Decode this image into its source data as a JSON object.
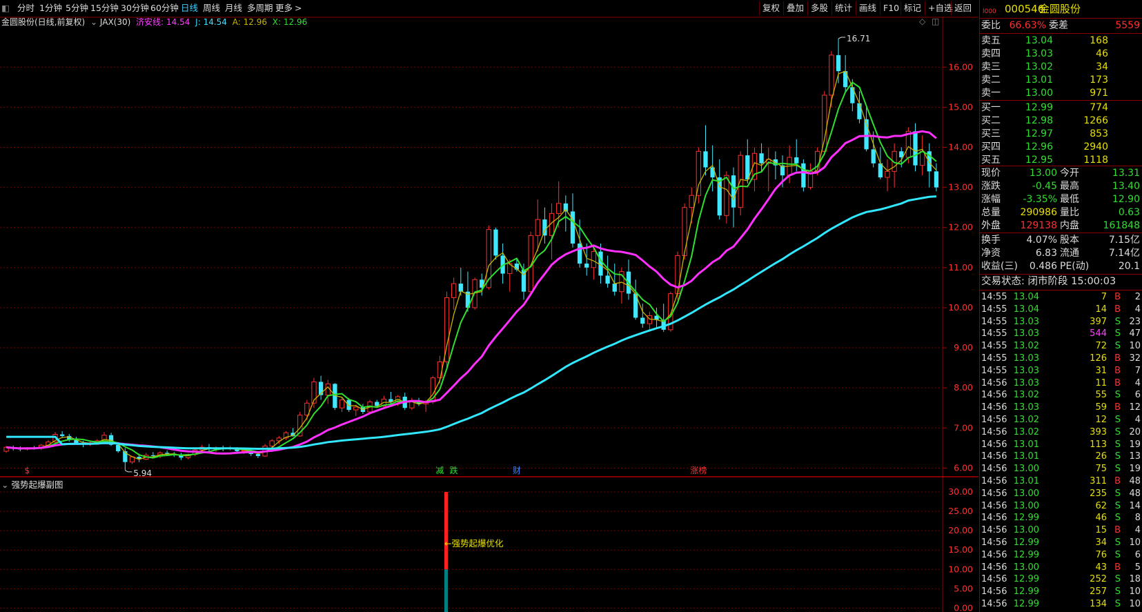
{
  "toolbar": {
    "periods": [
      "分时",
      "1分钟",
      "5分钟",
      "15分钟",
      "30分钟",
      "60分钟",
      "日线",
      "周线",
      "月线",
      "多周期",
      "更多"
    ],
    "active_period": "日线",
    "right_buttons": [
      "复权",
      "叠加",
      "多股",
      "统计",
      "画线",
      "F10",
      "标记",
      "+自选",
      "返回"
    ]
  },
  "legend": {
    "stock_title": "金圆股份(日线,前复权)",
    "indicator": "JAX(30)",
    "items": [
      {
        "label": "济安线: 14.54",
        "color": "#ff40ff"
      },
      {
        "label": "J: 14.54",
        "color": "#40e0ff"
      },
      {
        "label": "A: 12.96",
        "color": "#c8b400"
      },
      {
        "label": "X: 12.96",
        "color": "#30e030"
      }
    ]
  },
  "sub_chart": {
    "title": "强势起爆副图",
    "annotation": "←强势起爆优化",
    "y_labels": [
      "30.00",
      "25.00",
      "20.00",
      "15.00",
      "10.00",
      "5.00",
      "0.00"
    ],
    "bar": {
      "red_top": 30,
      "red_bottom": 10,
      "teal_top": 10,
      "teal_bottom": -1
    }
  },
  "chart_data": {
    "type": "candlestick",
    "y_labels": [
      "16.00",
      "15.00",
      "14.00",
      "13.00",
      "12.00",
      "11.00",
      "10.00",
      "9.00",
      "8.00",
      "7.00",
      "6.00"
    ],
    "ylim": [
      5.8,
      16.9
    ],
    "high_label": "16.71",
    "low_label": "5.94",
    "event_markers": [
      {
        "text": "$",
        "index": 3,
        "color": "#ff3030"
      },
      {
        "text": "减",
        "index": 62,
        "color": "#30e030"
      },
      {
        "text": "跌",
        "index": 64,
        "color": "#30e030"
      },
      {
        "text": "财",
        "index": 73,
        "color": "#4080ff"
      },
      {
        "text": "涨榜",
        "index": 99,
        "color": "#ff3030"
      }
    ],
    "candles": [
      [
        6.42,
        6.55,
        6.38,
        6.52
      ],
      [
        6.5,
        6.56,
        6.44,
        6.48
      ],
      [
        6.48,
        6.54,
        6.42,
        6.47
      ],
      [
        6.47,
        6.52,
        6.44,
        6.5
      ],
      [
        6.5,
        6.55,
        6.46,
        6.49
      ],
      [
        6.49,
        6.6,
        6.45,
        6.57
      ],
      [
        6.57,
        6.7,
        6.52,
        6.65
      ],
      [
        6.65,
        6.9,
        6.6,
        6.84
      ],
      [
        6.84,
        6.92,
        6.75,
        6.8
      ],
      [
        6.8,
        6.85,
        6.66,
        6.7
      ],
      [
        6.7,
        6.78,
        6.6,
        6.62
      ],
      [
        6.62,
        6.68,
        6.52,
        6.6
      ],
      [
        6.6,
        6.66,
        6.55,
        6.63
      ],
      [
        6.63,
        6.72,
        6.58,
        6.68
      ],
      [
        6.68,
        6.9,
        6.62,
        6.82
      ],
      [
        6.82,
        6.88,
        6.55,
        6.58
      ],
      [
        6.58,
        6.62,
        6.38,
        6.42
      ],
      [
        6.42,
        6.5,
        5.94,
        6.15
      ],
      [
        6.15,
        6.3,
        6.1,
        6.28
      ],
      [
        6.28,
        6.36,
        6.15,
        6.22
      ],
      [
        6.22,
        6.38,
        6.2,
        6.32
      ],
      [
        6.32,
        6.4,
        6.25,
        6.3
      ],
      [
        6.3,
        6.42,
        6.25,
        6.38
      ],
      [
        6.38,
        6.44,
        6.3,
        6.36
      ],
      [
        6.36,
        6.4,
        6.28,
        6.32
      ],
      [
        6.32,
        6.38,
        6.2,
        6.26
      ],
      [
        6.26,
        6.36,
        6.22,
        6.34
      ],
      [
        6.34,
        6.5,
        6.3,
        6.45
      ],
      [
        6.45,
        6.58,
        6.4,
        6.52
      ],
      [
        6.52,
        6.6,
        6.42,
        6.47
      ],
      [
        6.47,
        6.54,
        6.4,
        6.5
      ],
      [
        6.5,
        6.56,
        6.42,
        6.48
      ],
      [
        6.48,
        6.55,
        6.44,
        6.5
      ],
      [
        6.5,
        6.52,
        6.38,
        6.42
      ],
      [
        6.42,
        6.48,
        6.35,
        6.44
      ],
      [
        6.44,
        6.46,
        6.3,
        6.35
      ],
      [
        6.35,
        6.42,
        6.25,
        6.3
      ],
      [
        6.3,
        6.6,
        6.28,
        6.55
      ],
      [
        6.55,
        6.72,
        6.5,
        6.68
      ],
      [
        6.68,
        6.8,
        6.6,
        6.75
      ],
      [
        6.75,
        6.92,
        6.7,
        6.88
      ],
      [
        6.88,
        7.0,
        6.78,
        6.8
      ],
      [
        6.8,
        7.4,
        6.78,
        7.32
      ],
      [
        7.32,
        7.7,
        7.2,
        7.62
      ],
      [
        7.62,
        8.25,
        7.5,
        8.15
      ],
      [
        8.15,
        8.3,
        7.7,
        7.82
      ],
      [
        7.82,
        8.2,
        7.6,
        8.1
      ],
      [
        8.1,
        8.12,
        7.45,
        7.5
      ],
      [
        7.5,
        7.78,
        7.4,
        7.7
      ],
      [
        7.7,
        7.75,
        7.4,
        7.45
      ],
      [
        7.45,
        7.58,
        7.3,
        7.52
      ],
      [
        7.52,
        7.6,
        7.35,
        7.4
      ],
      [
        7.4,
        7.7,
        7.38,
        7.65
      ],
      [
        7.65,
        7.7,
        7.5,
        7.55
      ],
      [
        7.55,
        7.8,
        7.48,
        7.72
      ],
      [
        7.72,
        7.9,
        7.6,
        7.65
      ],
      [
        7.65,
        7.82,
        7.55,
        7.78
      ],
      [
        7.78,
        7.88,
        7.45,
        7.5
      ],
      [
        7.5,
        7.75,
        7.45,
        7.68
      ],
      [
        7.68,
        7.75,
        7.55,
        7.6
      ],
      [
        7.6,
        7.7,
        7.4,
        7.65
      ],
      [
        7.65,
        8.3,
        7.6,
        8.25
      ],
      [
        8.25,
        8.8,
        8.1,
        8.65
      ],
      [
        8.65,
        10.4,
        8.5,
        10.25
      ],
      [
        10.25,
        10.75,
        9.95,
        10.6
      ],
      [
        10.6,
        11.0,
        10.3,
        10.4
      ],
      [
        10.4,
        10.9,
        9.9,
        10.0
      ],
      [
        10.0,
        10.75,
        9.95,
        10.7
      ],
      [
        10.7,
        10.85,
        10.3,
        10.5
      ],
      [
        10.5,
        12.05,
        10.45,
        11.95
      ],
      [
        11.95,
        12.0,
        11.2,
        11.3
      ],
      [
        11.3,
        11.6,
        10.6,
        10.85
      ],
      [
        10.85,
        11.2,
        10.4,
        11.1
      ],
      [
        11.1,
        11.2,
        10.9,
        10.95
      ]
    ],
    "candles_b": [
      [
        10.95,
        11.1,
        10.2,
        10.4
      ],
      [
        10.4,
        11.9,
        10.3,
        11.8
      ],
      [
        11.8,
        12.7,
        11.4,
        12.2
      ],
      [
        12.2,
        12.5,
        11.6,
        11.8
      ],
      [
        11.8,
        12.6,
        11.2,
        12.35
      ],
      [
        12.35,
        13.15,
        12.0,
        12.6
      ],
      [
        12.6,
        12.8,
        11.9,
        12.4
      ],
      [
        12.4,
        12.85,
        11.5,
        11.6
      ],
      [
        11.6,
        12.2,
        11.0,
        11.1
      ],
      [
        11.1,
        11.6,
        10.8,
        11.0
      ],
      [
        11.0,
        11.5,
        10.7,
        11.4
      ],
      [
        11.4,
        11.6,
        10.6,
        10.8
      ],
      [
        10.8,
        11.3,
        10.5,
        10.6
      ],
      [
        10.6,
        11.1,
        10.3,
        10.4
      ],
      [
        10.4,
        11.0,
        10.1,
        10.9
      ],
      [
        10.9,
        11.2,
        10.2,
        10.35
      ],
      [
        10.35,
        10.7,
        9.7,
        9.75
      ],
      [
        9.75,
        10.1,
        9.5,
        9.6
      ],
      [
        9.6,
        9.9,
        9.4,
        9.8
      ],
      [
        9.8,
        10.0,
        9.5,
        9.7
      ],
      [
        9.7,
        10.1,
        9.4,
        9.45
      ],
      [
        9.45,
        10.4,
        9.4,
        10.35
      ],
      [
        10.35,
        11.4,
        10.2,
        11.3
      ],
      [
        11.3,
        12.6,
        11.2,
        12.5
      ],
      [
        12.5,
        13.0,
        12.1,
        12.8
      ],
      [
        12.8,
        14.0,
        12.6,
        13.9
      ],
      [
        13.9,
        14.55,
        13.3,
        13.5
      ],
      [
        13.5,
        14.05,
        12.9,
        13.25
      ],
      [
        13.25,
        13.7,
        12.2,
        12.3
      ],
      [
        12.3,
        13.4,
        12.1,
        13.3
      ],
      [
        13.3,
        13.5,
        12.0,
        12.5
      ],
      [
        12.5,
        13.9,
        12.3,
        13.8
      ],
      [
        13.8,
        14.2,
        13.1,
        13.2
      ],
      [
        13.2,
        14.0,
        12.9,
        13.85
      ],
      [
        13.85,
        14.1,
        13.4,
        13.6
      ],
      [
        13.6,
        14.0,
        12.9,
        13.7
      ],
      [
        13.7,
        13.9,
        13.2,
        13.55
      ],
      [
        13.55,
        13.8,
        13.0,
        13.3
      ],
      [
        13.3,
        14.05,
        13.1,
        13.75
      ],
      [
        13.75,
        14.2,
        13.4,
        13.6
      ],
      [
        13.6,
        13.7,
        12.9,
        13.0
      ],
      [
        13.0,
        13.6,
        12.95,
        13.4
      ],
      [
        13.4,
        14.0,
        13.3,
        13.9
      ],
      [
        13.9,
        15.4,
        13.8,
        15.3
      ],
      [
        15.3,
        16.4,
        15.0,
        16.3
      ],
      [
        16.3,
        16.71,
        15.6,
        15.9
      ],
      [
        15.9,
        16.3,
        15.4,
        15.5
      ],
      [
        15.5,
        15.7,
        14.9,
        15.1
      ],
      [
        15.1,
        15.4,
        14.6,
        14.7
      ],
      [
        14.7,
        15.0,
        13.9,
        13.95
      ],
      [
        13.95,
        14.4,
        13.5,
        13.6
      ],
      [
        13.6,
        14.0,
        13.2,
        13.25
      ],
      [
        13.25,
        13.7,
        12.9,
        13.4
      ],
      [
        13.4,
        14.1,
        13.0,
        13.9
      ],
      [
        13.9,
        14.0,
        13.5,
        13.75
      ],
      [
        13.75,
        14.5,
        13.6,
        14.4
      ],
      [
        14.4,
        14.6,
        13.4,
        13.55
      ],
      [
        13.55,
        14.3,
        13.3,
        13.9
      ],
      [
        13.9,
        14.1,
        13.0,
        13.4
      ],
      [
        13.4,
        13.6,
        12.9,
        13.0
      ]
    ],
    "series": [
      {
        "name": "济安线",
        "color": "#ff30ff",
        "values": [
          6.63,
          6.66,
          6.68,
          6.72,
          6.78,
          6.85,
          6.9,
          6.9,
          6.83,
          6.71,
          6.64,
          6.63,
          6.64,
          6.67,
          6.7,
          6.75,
          6.79,
          6.83,
          6.86,
          6.88,
          6.9,
          6.92,
          6.95,
          6.98,
          7.02,
          7.06,
          7.1,
          7.15,
          7.2,
          7.25,
          7.32,
          7.38,
          7.44,
          7.48,
          7.52,
          7.55,
          7.57,
          7.58,
          7.6,
          7.62,
          7.66,
          7.75,
          8.0,
          8.6,
          9.3,
          9.7,
          10.05,
          10.4,
          10.7,
          10.95
        ]
      },
      {
        "name": "J",
        "color": "#30e8ff",
        "values": [
          6.8,
          6.79,
          6.78,
          6.76,
          6.74,
          6.72,
          6.71,
          6.7,
          6.69,
          6.68,
          6.67,
          6.67,
          6.66,
          6.66,
          6.65
        ]
      }
    ]
  },
  "panel": {
    "code": "000546",
    "name": "金圆股份",
    "weibi_label": "委比",
    "weibi_val": "66.63%",
    "weicha_label": "委差",
    "weicha_val": "5559",
    "sell": [
      {
        "label": "卖五",
        "price": "13.04",
        "vol": "168"
      },
      {
        "label": "卖四",
        "price": "13.03",
        "vol": "46"
      },
      {
        "label": "卖三",
        "price": "13.02",
        "vol": "34"
      },
      {
        "label": "卖二",
        "price": "13.01",
        "vol": "173"
      },
      {
        "label": "卖一",
        "price": "13.00",
        "vol": "971"
      }
    ],
    "buy": [
      {
        "label": "买一",
        "price": "12.99",
        "vol": "774"
      },
      {
        "label": "买二",
        "price": "12.98",
        "vol": "1266"
      },
      {
        "label": "买三",
        "price": "12.97",
        "vol": "853"
      },
      {
        "label": "买四",
        "price": "12.96",
        "vol": "2940"
      },
      {
        "label": "买五",
        "price": "12.95",
        "vol": "1118"
      }
    ],
    "quote": [
      {
        "l1": "现价",
        "v1": "13.00",
        "c1": "#30e030",
        "l2": "今开",
        "v2": "13.31",
        "c2": "#30e030"
      },
      {
        "l1": "涨跌",
        "v1": "-0.45",
        "c1": "#30e030",
        "l2": "最高",
        "v2": "13.40",
        "c2": "#30e030"
      },
      {
        "l1": "涨幅",
        "v1": "-3.35%",
        "c1": "#30e030",
        "l2": "最低",
        "v2": "12.90",
        "c2": "#30e030"
      },
      {
        "l1": "总量",
        "v1": "290986",
        "c1": "#e8e000",
        "l2": "量比",
        "v2": "0.63",
        "c2": "#30e030"
      },
      {
        "l1": "外盘",
        "v1": "129138",
        "c1": "#ff3030",
        "l2": "内盘",
        "v2": "161848",
        "c2": "#30e030"
      }
    ],
    "quote2": [
      {
        "l1": "换手",
        "v1": "4.07%",
        "l2": "股本",
        "v2": "7.15亿"
      },
      {
        "l1": "净资",
        "v1": "6.83",
        "l2": "流通",
        "v2": "7.14亿"
      },
      {
        "l1": "收益(三)",
        "v1": "0.486",
        "l2": "PE(动)",
        "v2": "20.1"
      }
    ],
    "trade_status": "交易状态: 闭市阶段 15:00:03",
    "ticks": [
      [
        "14:55",
        "13.04",
        "7",
        "B",
        "2"
      ],
      [
        "14:55",
        "13.04",
        "14",
        "B",
        "4"
      ],
      [
        "14:55",
        "13.03",
        "397",
        "S",
        "23"
      ],
      [
        "14:55",
        "13.03",
        "544",
        "S",
        "47"
      ],
      [
        "14:55",
        "13.02",
        "72",
        "S",
        "10"
      ],
      [
        "14:55",
        "13.03",
        "126",
        "B",
        "32"
      ],
      [
        "14:55",
        "13.03",
        "31",
        "B",
        "7"
      ],
      [
        "14:56",
        "13.03",
        "11",
        "B",
        "4"
      ],
      [
        "14:56",
        "13.02",
        "55",
        "S",
        "6"
      ],
      [
        "14:56",
        "13.03",
        "59",
        "B",
        "12"
      ],
      [
        "14:56",
        "13.02",
        "12",
        "S",
        "4"
      ],
      [
        "14:56",
        "13.02",
        "393",
        "S",
        "20"
      ],
      [
        "14:56",
        "13.01",
        "113",
        "S",
        "19"
      ],
      [
        "14:56",
        "13.01",
        "26",
        "S",
        "13"
      ],
      [
        "14:56",
        "13.00",
        "75",
        "S",
        "19"
      ],
      [
        "14:56",
        "13.01",
        "311",
        "B",
        "48"
      ],
      [
        "14:56",
        "13.00",
        "235",
        "S",
        "48"
      ],
      [
        "14:56",
        "13.00",
        "62",
        "S",
        "14"
      ],
      [
        "14:56",
        "12.99",
        "46",
        "S",
        "8"
      ],
      [
        "14:56",
        "13.00",
        "15",
        "B",
        "4"
      ],
      [
        "14:56",
        "12.99",
        "34",
        "S",
        "10"
      ],
      [
        "14:56",
        "12.99",
        "76",
        "S",
        "6"
      ],
      [
        "14:56",
        "13.00",
        "43",
        "B",
        "5"
      ],
      [
        "14:56",
        "12.99",
        "252",
        "S",
        "18"
      ],
      [
        "14:56",
        "12.99",
        "257",
        "S",
        "10"
      ],
      [
        "14:56",
        "12.99",
        "134",
        "S",
        "10"
      ]
    ]
  }
}
